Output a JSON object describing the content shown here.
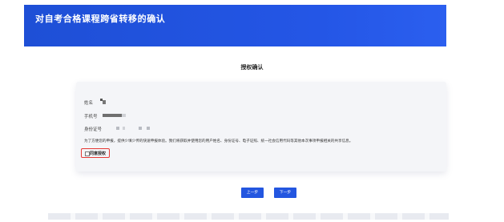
{
  "header": {
    "title": "对自考合格课程跨省转移的确认"
  },
  "page_title": "授权确认",
  "fields": {
    "name_label": "姓名",
    "phone_label": "手机号",
    "id_label": "身份证号"
  },
  "notice": "为了方便您的申报，提供少填少传的快速申报体验。我们将获取并使用您的用户姓名、身份证号、电子证照、统一社会信用代码等其他本次事项申报相关的共享信息。",
  "consent": {
    "label": "同意授权",
    "checked": false
  },
  "buttons": {
    "prev": "上一步",
    "next": "下一步"
  }
}
